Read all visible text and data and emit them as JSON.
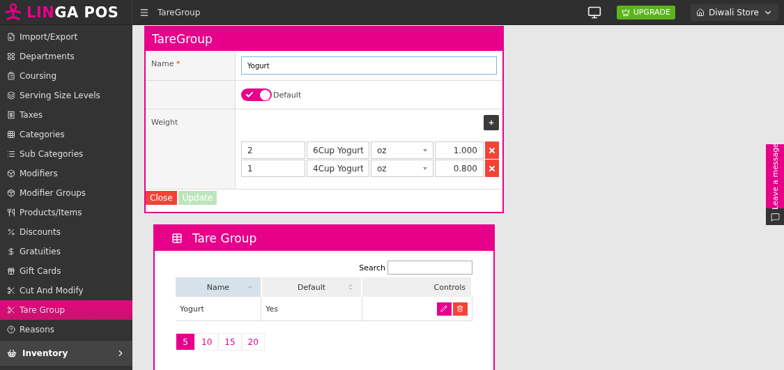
{
  "logo": {
    "accent": "LIN",
    "rest": "GA POS"
  },
  "topbar": {
    "title": "TareGroup",
    "upgrade": "UPGRADE",
    "store": "Diwali Store"
  },
  "sidebar": {
    "items": [
      {
        "label": "Import/Export",
        "selected": false
      },
      {
        "label": "Departments",
        "selected": false
      },
      {
        "label": "Coursing",
        "selected": false
      },
      {
        "label": "Serving Size Levels",
        "selected": false
      },
      {
        "label": "Taxes",
        "selected": false
      },
      {
        "label": "Categories",
        "selected": false
      },
      {
        "label": "Sub Categories",
        "selected": false
      },
      {
        "label": "Modifiers",
        "selected": false
      },
      {
        "label": "Modifier Groups",
        "selected": false
      },
      {
        "label": "Products/Items",
        "selected": false
      },
      {
        "label": "Discounts",
        "selected": false
      },
      {
        "label": "Gratuities",
        "selected": false
      },
      {
        "label": "Gift Cards",
        "selected": false
      },
      {
        "label": "Cut And Modify",
        "selected": false
      },
      {
        "label": "Tare Group",
        "selected": true
      },
      {
        "label": "Reasons",
        "selected": false
      }
    ],
    "section": {
      "label": "Inventory"
    }
  },
  "form": {
    "title": "TareGroup",
    "name_label": "Name",
    "required_mark": "*",
    "name_value": "Yogurt",
    "default_toggle": {
      "label": "Default",
      "on": true
    },
    "weight_label": "Weight",
    "weights": [
      {
        "quantity": "2",
        "name": "6Cup Yogurt",
        "unit": "oz",
        "value": "1.000"
      },
      {
        "quantity": "1",
        "name": "4Cup Yogurt",
        "unit": "oz",
        "value": "0.800"
      }
    ],
    "close": "Close",
    "update": {
      "label": "Update",
      "disabled": true
    }
  },
  "list": {
    "title": "Tare Group",
    "search_label": "Search",
    "columns": [
      {
        "label": "Name",
        "sortable": true,
        "sorted": true
      },
      {
        "label": "Default",
        "sortable": true,
        "sorted": false
      },
      {
        "label": "Controls",
        "sortable": false,
        "sorted": false
      }
    ],
    "rows": [
      {
        "cells": [
          "Yogurt",
          "Yes"
        ]
      }
    ],
    "page_sizes": [
      {
        "label": "5",
        "selected": true
      },
      {
        "label": "10",
        "selected": false
      },
      {
        "label": "15",
        "selected": false
      },
      {
        "label": "20",
        "selected": false
      }
    ]
  },
  "feedback": {
    "label": "Leave a message"
  }
}
